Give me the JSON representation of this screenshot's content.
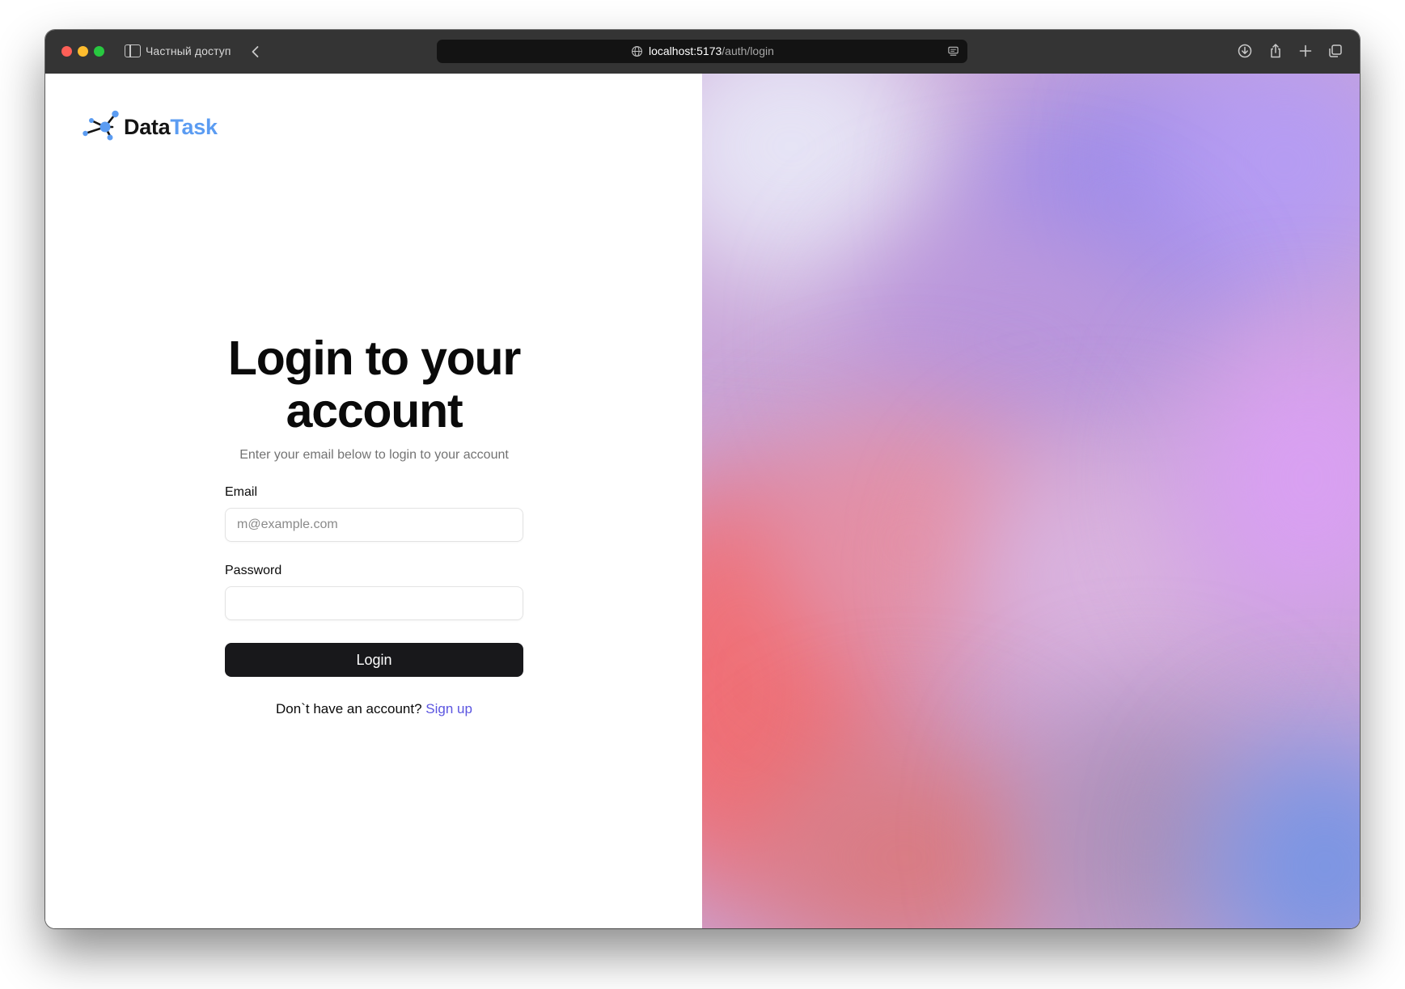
{
  "browser": {
    "private_label": "Частный доступ",
    "url_host": "localhost:5173",
    "url_path": "/auth/login"
  },
  "brand": {
    "name_part1": "Data",
    "name_part2": "Task",
    "accent_color": "#5b9cf2"
  },
  "login_form": {
    "title": "Login to your account",
    "subtitle": "Enter your email below to login to your account",
    "email_label": "Email",
    "email_placeholder": "m@example.com",
    "email_value": "",
    "password_label": "Password",
    "password_value": "",
    "submit_label": "Login",
    "signup_prompt": "Don`t have an account?",
    "signup_link": "Sign up"
  },
  "colors": {
    "button_bg": "#18181b",
    "link": "#5b55e0",
    "gradient_colors": [
      "#f06f75",
      "#a18ce8",
      "#d39ef0",
      "#7a95e3"
    ]
  },
  "icons": {
    "toolbar": [
      "sidebar-toggle-icon",
      "back-chevron-icon",
      "globe-icon",
      "reader-icon",
      "download-icon",
      "share-icon",
      "plus-icon",
      "tabs-icon"
    ]
  }
}
